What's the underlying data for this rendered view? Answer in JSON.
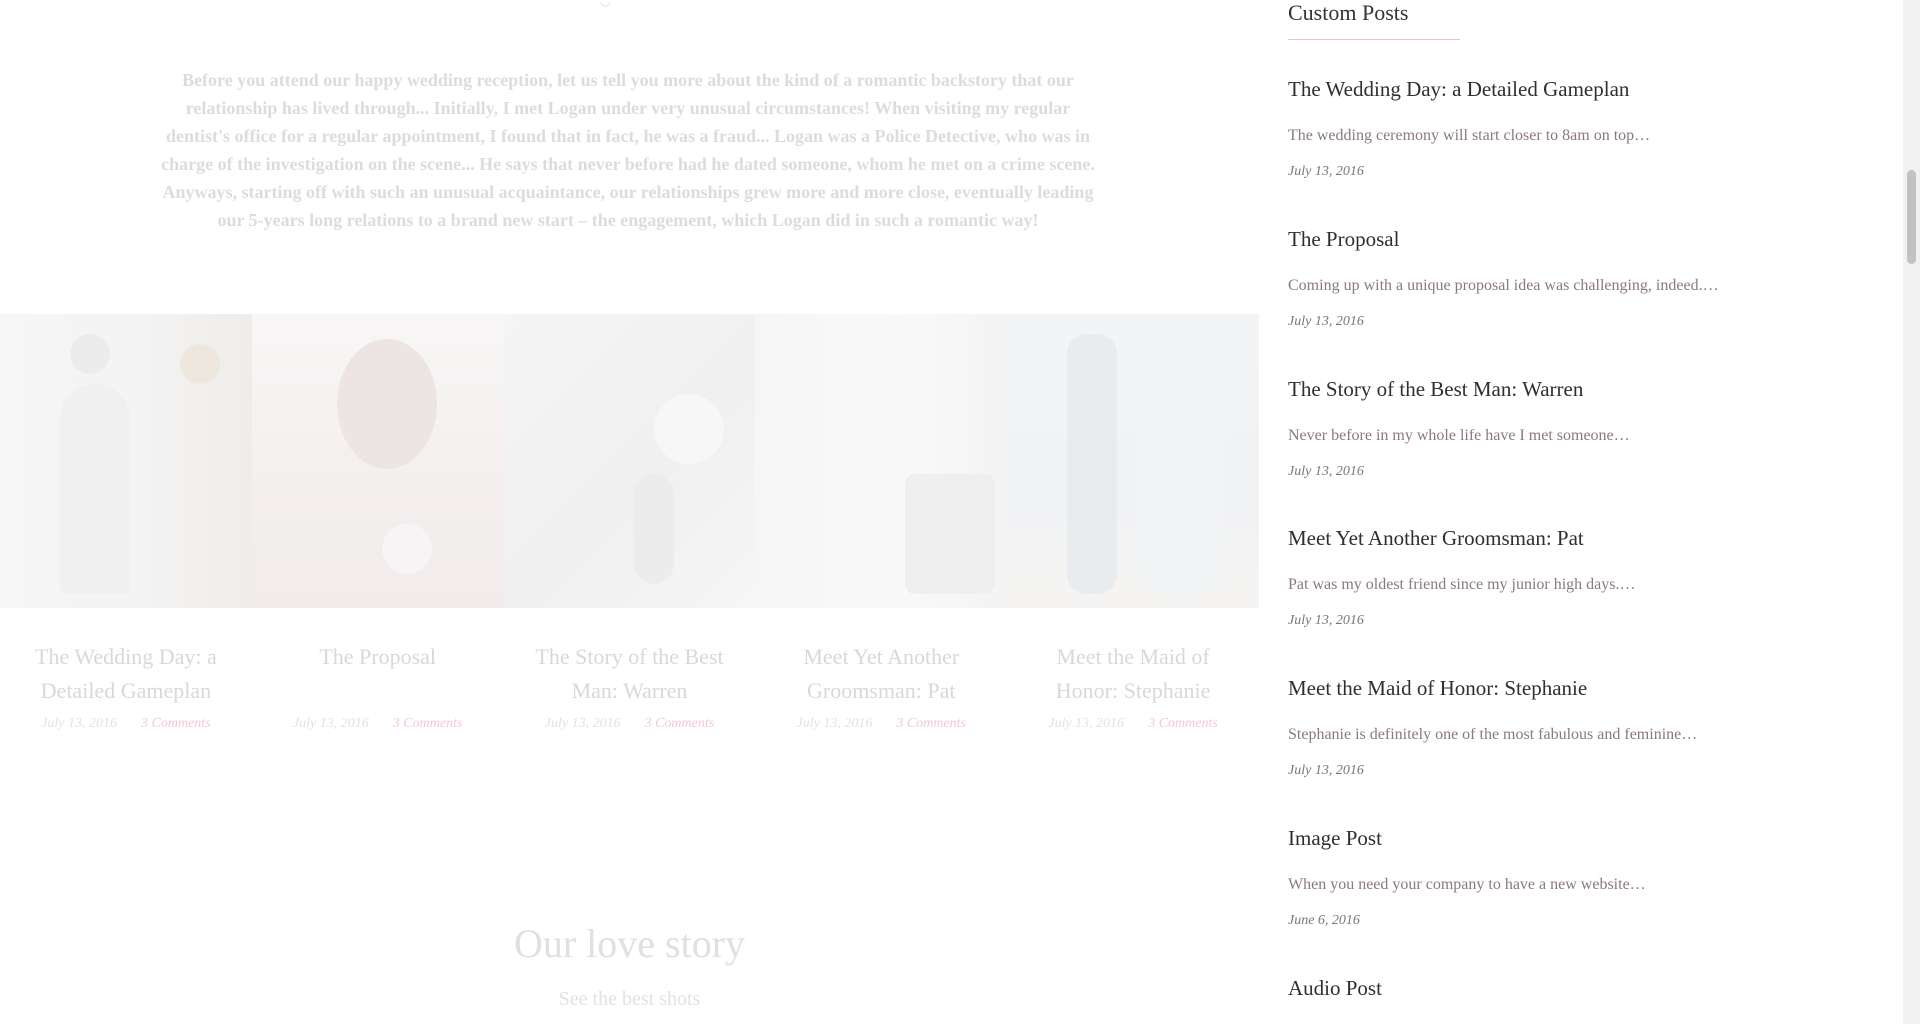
{
  "main": {
    "intro_text": "Before you attend our happy wedding reception, let us tell you more about the kind of a romantic backstory that our relationship has lived through... Initially, I met Logan under very unusual circumstances! When visiting my regular dentist's office for a regular appointment, I found that in fact, he was a fraud... Logan was a Police Detective, who was in charge of the investigation on the scene... He says that never before had he dated someone, whom he met on a crime scene. Anyways, starting off with such an unusual acquaintance, our relationships grew more and more close, eventually leading our 5-years long relations to a brand new start – the engagement, which Logan did in such a romantic way!",
    "cards": [
      {
        "title": "The Wedding Day: a Detailed Gameplan",
        "date": "July 13, 2016",
        "comments": "3 Comments"
      },
      {
        "title": "The Proposal",
        "date": "July 13, 2016",
        "comments": "3 Comments"
      },
      {
        "title": "The Story of the Best Man: Warren",
        "date": "July 13, 2016",
        "comments": "3 Comments"
      },
      {
        "title": "Meet Yet Another Groomsman: Pat",
        "date": "July 13, 2016",
        "comments": "3 Comments"
      },
      {
        "title": "Meet the Maid of Honor: Stephanie",
        "date": "July 13, 2016",
        "comments": "3 Comments"
      }
    ],
    "story_heading": "Our love story",
    "story_sub": "See the best shots"
  },
  "sidebar": {
    "title": "Custom Posts",
    "posts": [
      {
        "title": "The Wedding Day: a Detailed Gameplan",
        "excerpt": "The wedding ceremony will start closer to 8am on top…",
        "date": "July 13, 2016"
      },
      {
        "title": "The Proposal",
        "excerpt": "Coming up with a unique proposal idea was challenging, indeed.…",
        "date": "July 13, 2016"
      },
      {
        "title": "The Story of the Best Man: Warren",
        "excerpt": "Never before in my whole life have I met someone…",
        "date": "July 13, 2016"
      },
      {
        "title": "Meet Yet Another Groomsman: Pat",
        "excerpt": "Pat was my oldest friend since my junior high days.…",
        "date": "July 13, 2016"
      },
      {
        "title": "Meet the Maid of Honor: Stephanie",
        "excerpt": "Stephanie is definitely one of the most fabulous and feminine…",
        "date": "July 13, 2016"
      },
      {
        "title": "Image Post",
        "excerpt": "When you need your company to have a new website…",
        "date": "June 6, 2016"
      },
      {
        "title": "Audio Post",
        "excerpt": "",
        "date": ""
      }
    ]
  }
}
